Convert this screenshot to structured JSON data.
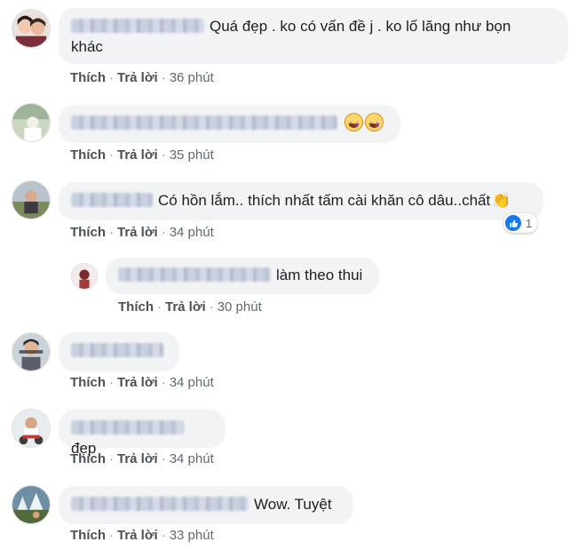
{
  "action_labels": {
    "like": "Thích",
    "reply": "Trả lời",
    "separator": "·"
  },
  "comments": [
    {
      "text_line1": "Quá đẹp . ko có vấn đề j . ko lố lăng như bọn",
      "text_line2": "khác",
      "time": "36 phút"
    },
    {
      "text": "",
      "emoji": "star-struck-emoji ×2",
      "time": "35 phút"
    },
    {
      "text": "Có hồn lắm.. thích nhất tấm cài khăn cô dâu..chất",
      "emoji": "clapping-hands-emoji",
      "reaction_count": "1",
      "time": "34 phút"
    },
    {
      "text": "làm theo thui",
      "time": "30 phút",
      "is_reply": true
    },
    {
      "text": "",
      "time": "34 phút"
    },
    {
      "text": "đẹp",
      "time": "34 phút"
    },
    {
      "text": "Wow. Tuyệt",
      "time": "33 phút"
    }
  ],
  "colors": {
    "bubble_bg": "#f2f3f5",
    "action_link": "#4b4f56",
    "like_blue": "#1877f2"
  }
}
